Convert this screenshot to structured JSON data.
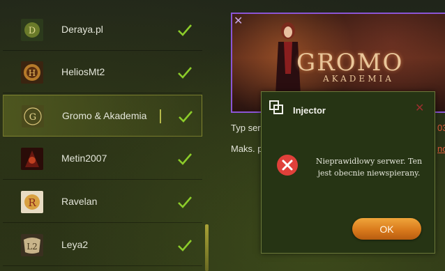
{
  "servers": [
    {
      "name": "Deraya.pl",
      "icon": "deraya-logo-icon",
      "checked": true,
      "active": false
    },
    {
      "name": "HeliosMt2",
      "icon": "helios-logo-icon",
      "checked": true,
      "active": false
    },
    {
      "name": "Gromo & Akademia",
      "icon": "gromo-logo-icon",
      "checked": true,
      "active": true
    },
    {
      "name": "Metin2007",
      "icon": "metin2007-logo-icon",
      "checked": true,
      "active": false
    },
    {
      "name": "Ravelan",
      "icon": "ravelan-logo-icon",
      "checked": true,
      "active": false
    },
    {
      "name": "Leya2",
      "icon": "leya2-logo-icon",
      "checked": true,
      "active": false
    }
  ],
  "banner": {
    "close_glyph": "✕",
    "logo_title": "GROMO",
    "logo_subtitle": "AKADEMIA"
  },
  "info": {
    "type_label": "Typ ser",
    "type_value": "03",
    "max_label": "Maks. p",
    "max_value": "no."
  },
  "dialog": {
    "title": "Injector",
    "close_glyph": "✕",
    "message": "Nieprawidłowy serwer. Ten jest obecnie niewspierany.",
    "ok_label": "OK"
  },
  "colors": {
    "accent_check": "#8ccc2a",
    "active_border": "#aaaa3c",
    "error_red": "#e0403a",
    "ok_button": "#e08a22"
  }
}
